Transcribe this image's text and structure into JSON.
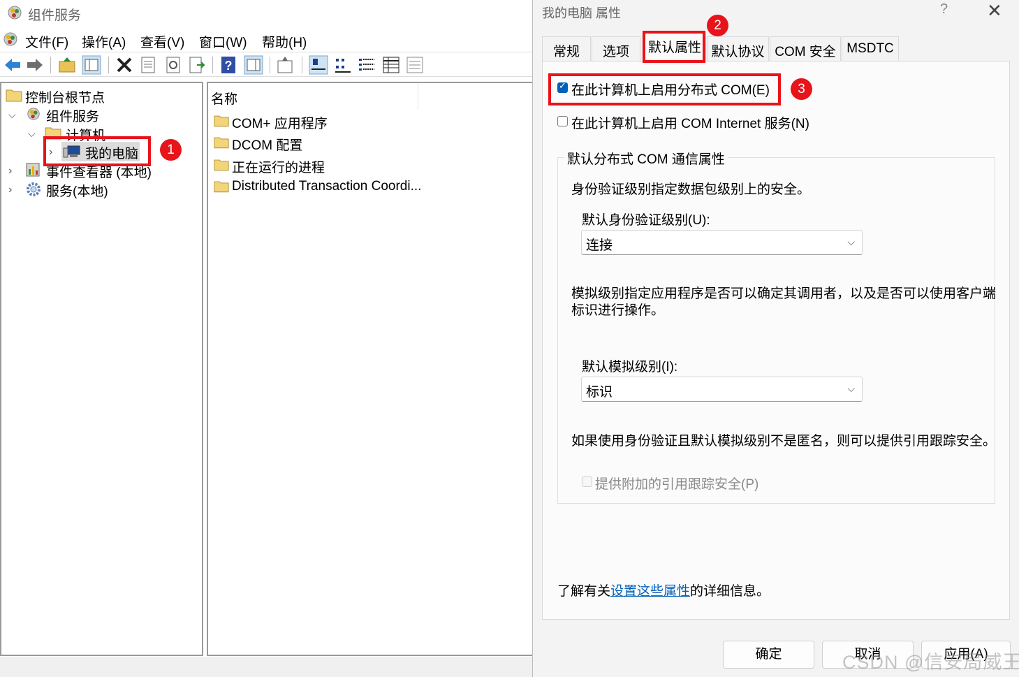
{
  "mmc": {
    "title": "组件服务",
    "menu": [
      "文件(F)",
      "操作(A)",
      "查看(V)",
      "窗口(W)",
      "帮助(H)"
    ],
    "tree": {
      "root": "控制台根节点",
      "component_services": "组件服务",
      "computers": "计算机",
      "my_computer": "我的电脑",
      "event_viewer": "事件查看器 (本地)",
      "services": "服务(本地)"
    },
    "list": {
      "header": "名称",
      "items": [
        "COM+ 应用程序",
        "DCOM 配置",
        "正在运行的进程",
        "Distributed Transaction Coordi..."
      ]
    }
  },
  "annotations": [
    "1",
    "2",
    "3"
  ],
  "dialog": {
    "title": "我的电脑 属性",
    "help": "?",
    "close": "✕",
    "tabs": [
      "常规",
      "选项",
      "默认属性",
      "默认协议",
      "COM 安全",
      "MSDTC"
    ],
    "active_tab": "默认属性",
    "enable_dcom": {
      "label": "在此计算机上启用分布式 COM(E)",
      "checked": true
    },
    "enable_cis": {
      "label": "在此计算机上启用 COM Internet 服务(N)",
      "checked": false
    },
    "group": {
      "title": "默认分布式 COM 通信属性",
      "auth_desc": "身份验证级别指定数据包级别上的安全。",
      "auth_label": "默认身份验证级别(U):",
      "auth_value": "连接",
      "imp_desc_1": "模拟级别指定应用程序是否可以确定其调用者，以及是否可以使用客户端",
      "imp_desc_2": "标识进行操作。",
      "imp_label": "默认模拟级别(I):",
      "imp_value": "标识",
      "ref_desc": "如果使用身份验证且默认模拟级别不是匿名，则可以提供引用跟踪安全。",
      "ref_check": {
        "label": "提供附加的引用跟踪安全(P)",
        "checked": false,
        "enabled": false
      }
    },
    "info_prefix": "了解有关",
    "info_link": "设置这些属性",
    "info_suffix": "的详细信息。",
    "buttons": {
      "ok": "确定",
      "cancel": "取消",
      "apply": "应用(A)"
    }
  },
  "watermark": "CSDN @信安局威王"
}
